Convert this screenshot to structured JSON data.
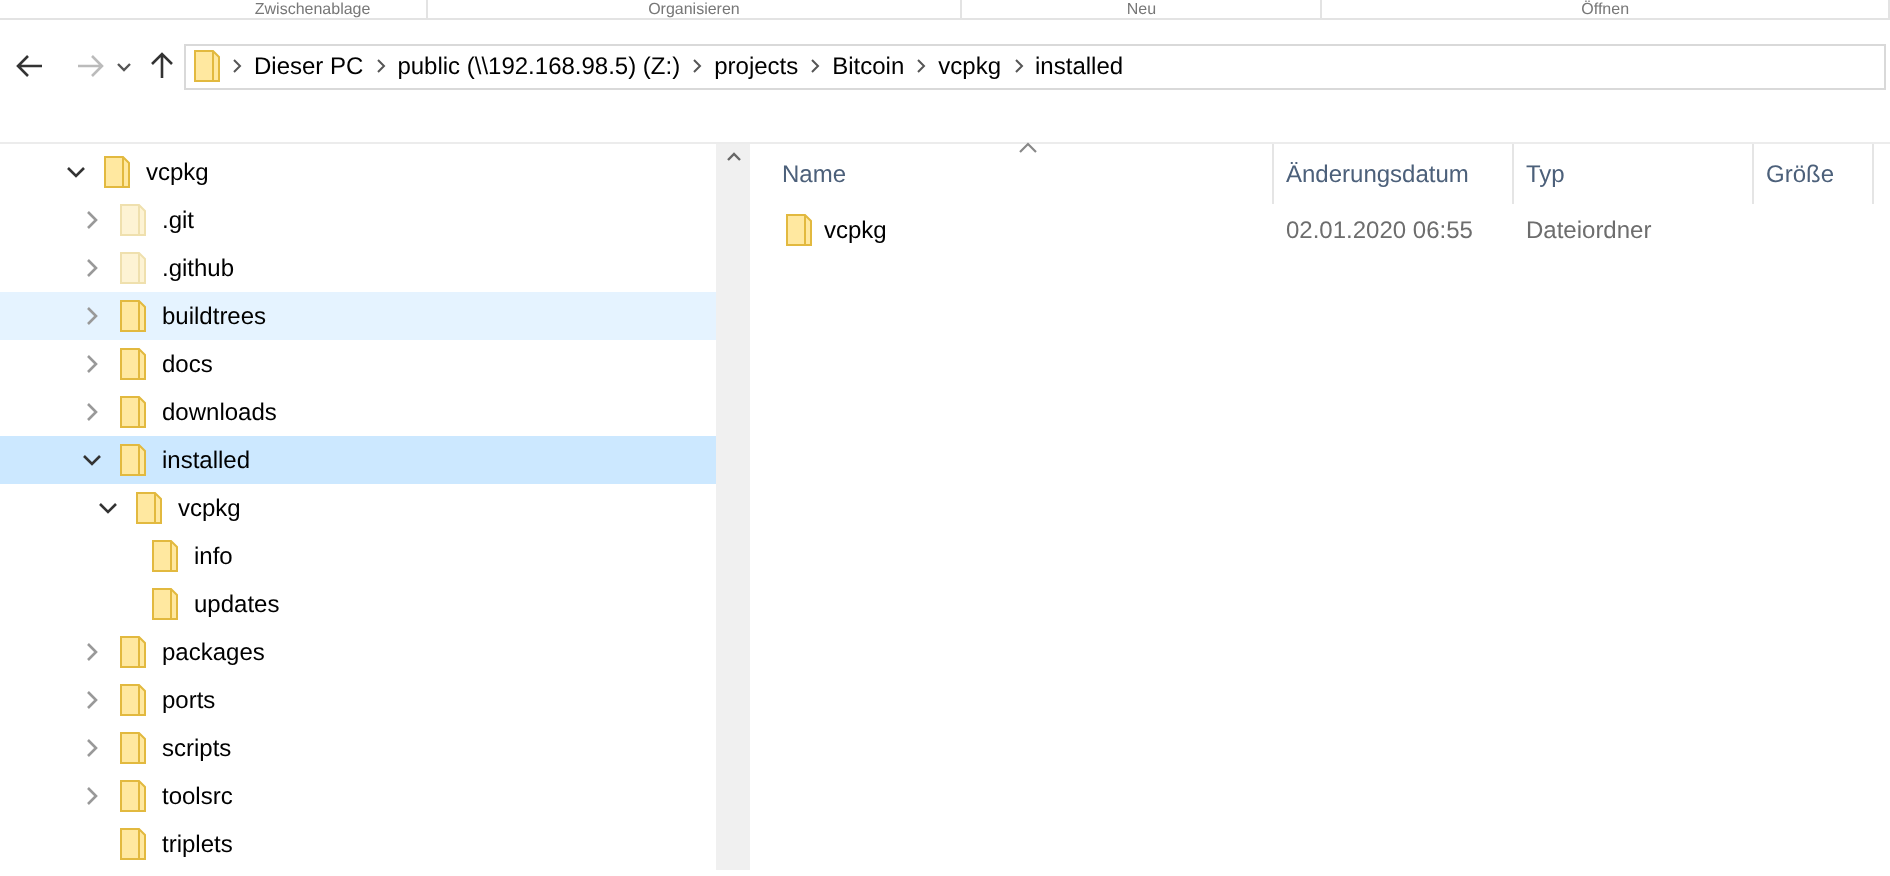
{
  "ribbon_groups": [
    "Zwischenablage",
    "Organisieren",
    "Neu",
    "Öffnen"
  ],
  "address_bar": {
    "crumbs": [
      "Dieser PC",
      "public (\\\\192.168.98.5) (Z:)",
      "projects",
      "Bitcoin",
      "vcpkg",
      "installed"
    ]
  },
  "tree": [
    {
      "label": "vcpkg",
      "expandable": true,
      "expanded": true,
      "selected": false,
      "hovered": false,
      "hidden": false,
      "children": [
        {
          "label": ".git",
          "expandable": true,
          "expanded": false,
          "selected": false,
          "hovered": false,
          "hidden": true
        },
        {
          "label": ".github",
          "expandable": true,
          "expanded": false,
          "selected": false,
          "hovered": false,
          "hidden": true
        },
        {
          "label": "buildtrees",
          "expandable": true,
          "expanded": false,
          "selected": false,
          "hovered": true,
          "hidden": false
        },
        {
          "label": "docs",
          "expandable": true,
          "expanded": false,
          "selected": false,
          "hovered": false,
          "hidden": false
        },
        {
          "label": "downloads",
          "expandable": true,
          "expanded": false,
          "selected": false,
          "hovered": false,
          "hidden": false
        },
        {
          "label": "installed",
          "expandable": true,
          "expanded": true,
          "selected": true,
          "hovered": false,
          "hidden": false,
          "children": [
            {
              "label": "vcpkg",
              "expandable": true,
              "expanded": true,
              "selected": false,
              "hovered": false,
              "hidden": false,
              "children": [
                {
                  "label": "info",
                  "expandable": false,
                  "expanded": false,
                  "selected": false,
                  "hovered": false,
                  "hidden": false
                },
                {
                  "label": "updates",
                  "expandable": false,
                  "expanded": false,
                  "selected": false,
                  "hovered": false,
                  "hidden": false
                }
              ]
            }
          ]
        },
        {
          "label": "packages",
          "expandable": true,
          "expanded": false,
          "selected": false,
          "hovered": false,
          "hidden": false
        },
        {
          "label": "ports",
          "expandable": true,
          "expanded": false,
          "selected": false,
          "hovered": false,
          "hidden": false
        },
        {
          "label": "scripts",
          "expandable": true,
          "expanded": false,
          "selected": false,
          "hovered": false,
          "hidden": false
        },
        {
          "label": "toolsrc",
          "expandable": true,
          "expanded": false,
          "selected": false,
          "hovered": false,
          "hidden": false
        },
        {
          "label": "triplets",
          "expandable": false,
          "expanded": false,
          "selected": false,
          "hovered": false,
          "hidden": false
        }
      ]
    }
  ],
  "file_list": {
    "columns": [
      "Name",
      "Änderungsdatum",
      "Typ",
      "Größe"
    ],
    "rows": [
      {
        "name": "vcpkg",
        "modified": "02.01.2020 06:55",
        "type": "Dateiordner"
      }
    ]
  }
}
